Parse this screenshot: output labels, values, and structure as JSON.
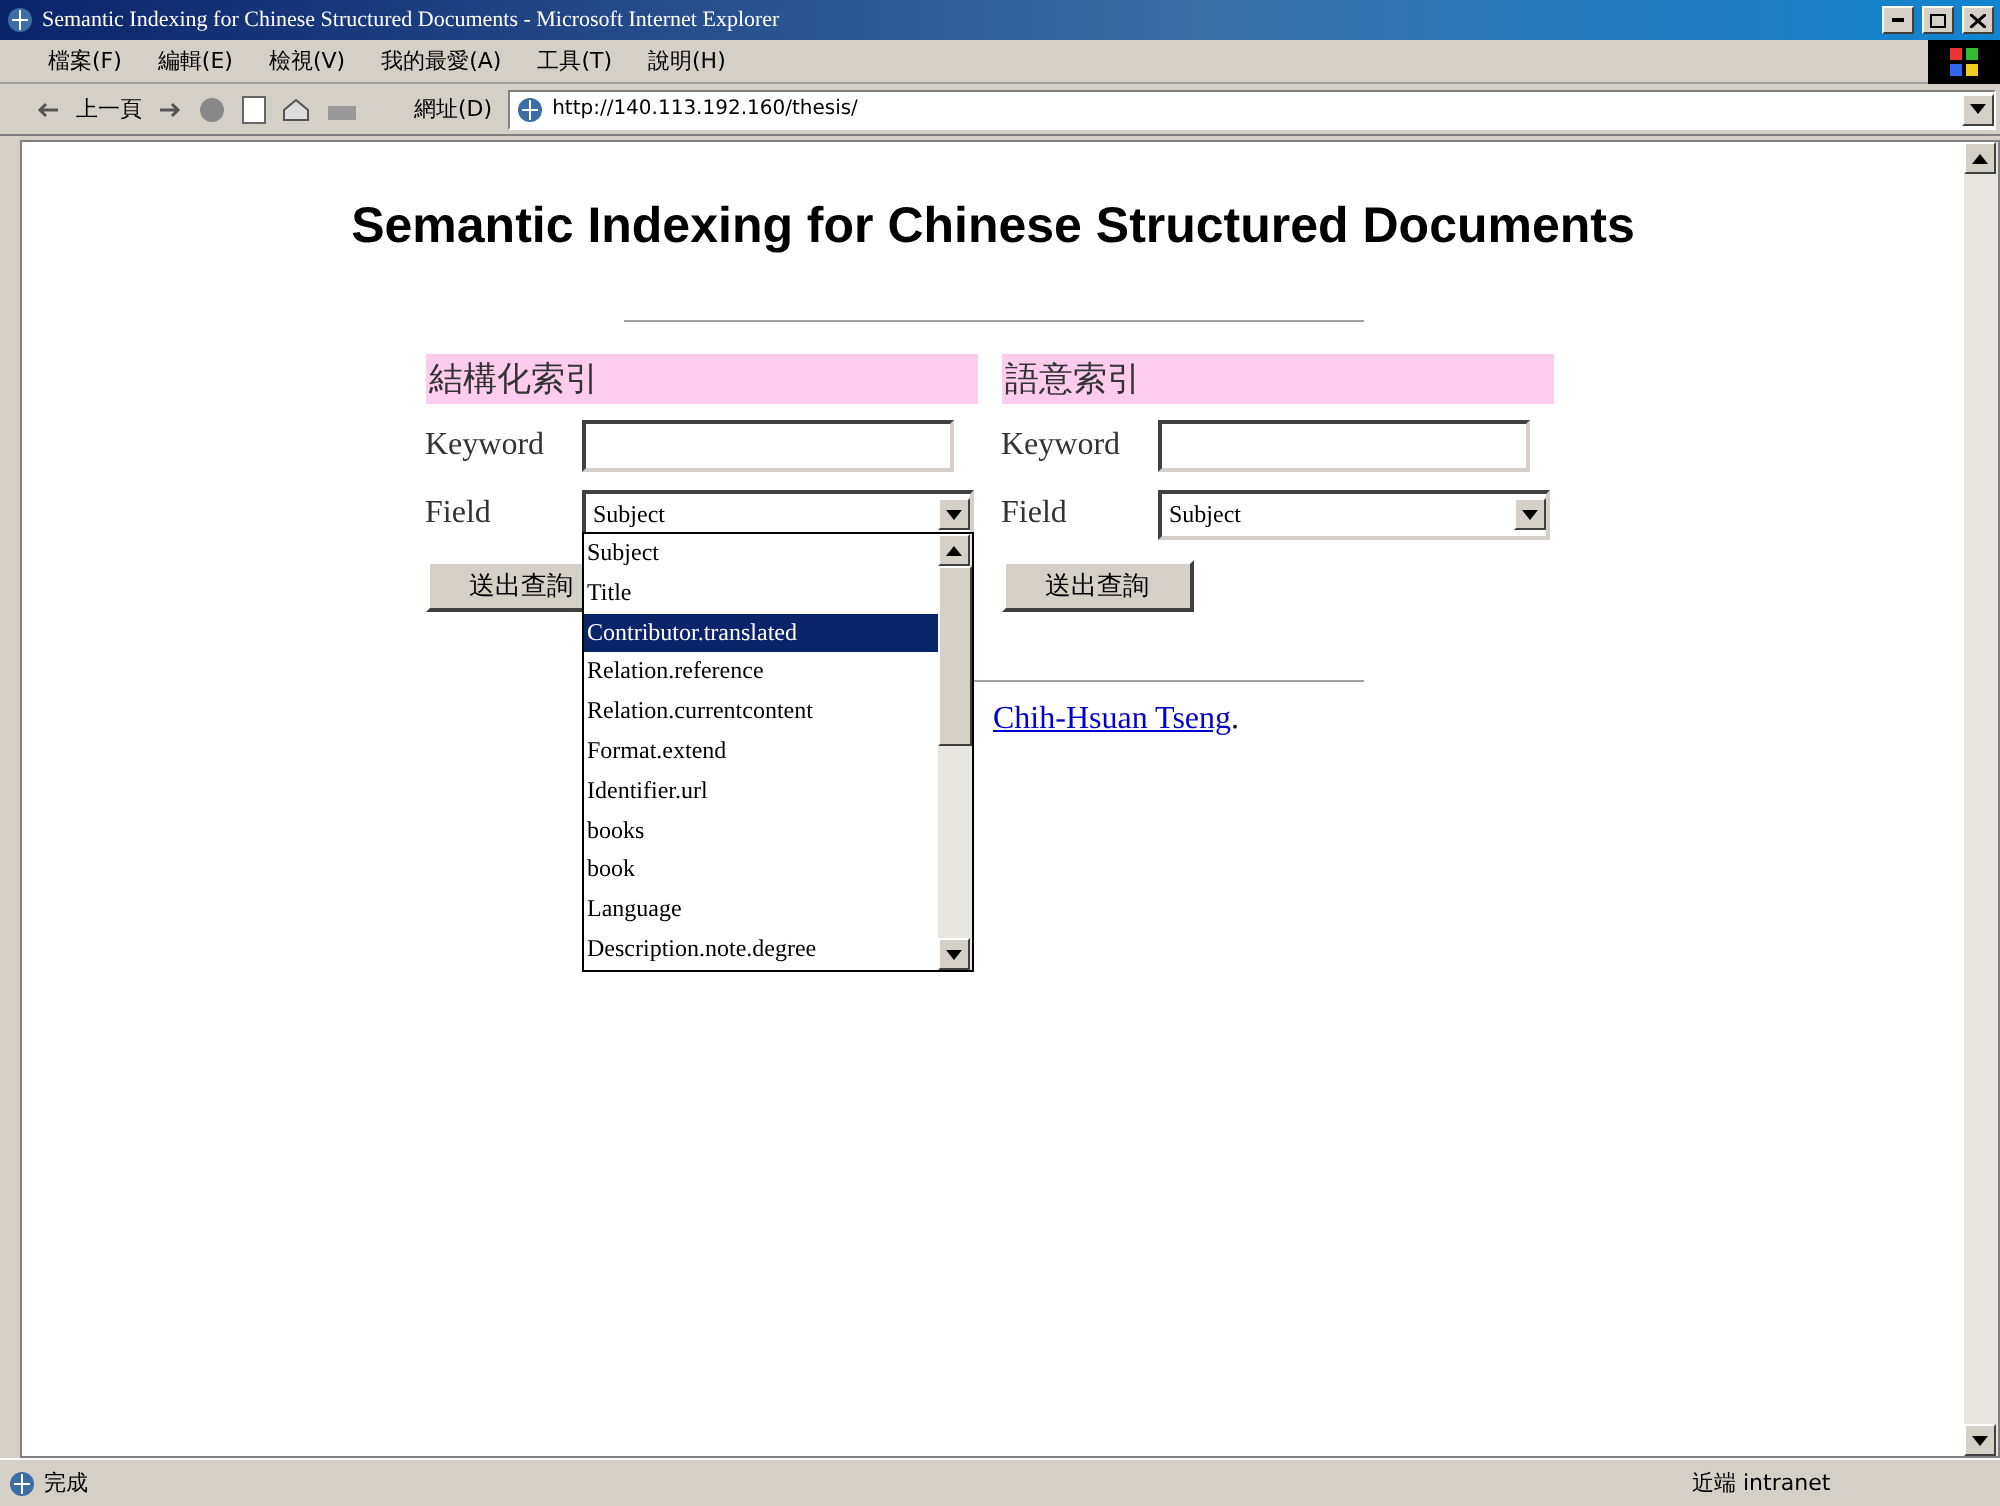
{
  "window": {
    "title": "Semantic Indexing for Chinese Structured Documents - Microsoft Internet Explorer"
  },
  "menu": [
    "檔案(F)",
    "編輯(E)",
    "檢視(V)",
    "我的最愛(A)",
    "工具(T)",
    "說明(H)"
  ],
  "toolbar": {
    "back": "上一頁",
    "address_label": "網址(D)",
    "address": "http://140.113.192.160/thesis/"
  },
  "page": {
    "title": "Semantic Indexing for Chinese Structured Documents",
    "forms": [
      {
        "heading": "結構化索引",
        "keyword_label": "Keyword",
        "field_label": "Field",
        "field_value": "Subject",
        "submit": "送出查詢",
        "expanded": true
      },
      {
        "heading": "語意索引",
        "keyword_label": "Keyword",
        "field_label": "Field",
        "field_value": "Subject",
        "submit": "送出查詢",
        "expanded": false
      }
    ],
    "options": [
      {
        "label": "Subject",
        "selected": false
      },
      {
        "label": "Title",
        "selected": false
      },
      {
        "label": "Contributor.translated",
        "selected": true
      },
      {
        "label": "Relation.reference",
        "selected": false
      },
      {
        "label": "Relation.currentcontent",
        "selected": false
      },
      {
        "label": "Format.extend",
        "selected": false
      },
      {
        "label": "Identifier.url",
        "selected": false
      },
      {
        "label": "books",
        "selected": false
      },
      {
        "label": "book",
        "selected": false
      },
      {
        "label": "Language",
        "selected": false
      },
      {
        "label": "Description.note.degree",
        "selected": false
      }
    ],
    "footer": {
      "link": "Chih-Hsuan Tseng",
      "tail": "."
    }
  },
  "status_bar": {
    "text": "完成",
    "zone": "近端 intranet"
  }
}
